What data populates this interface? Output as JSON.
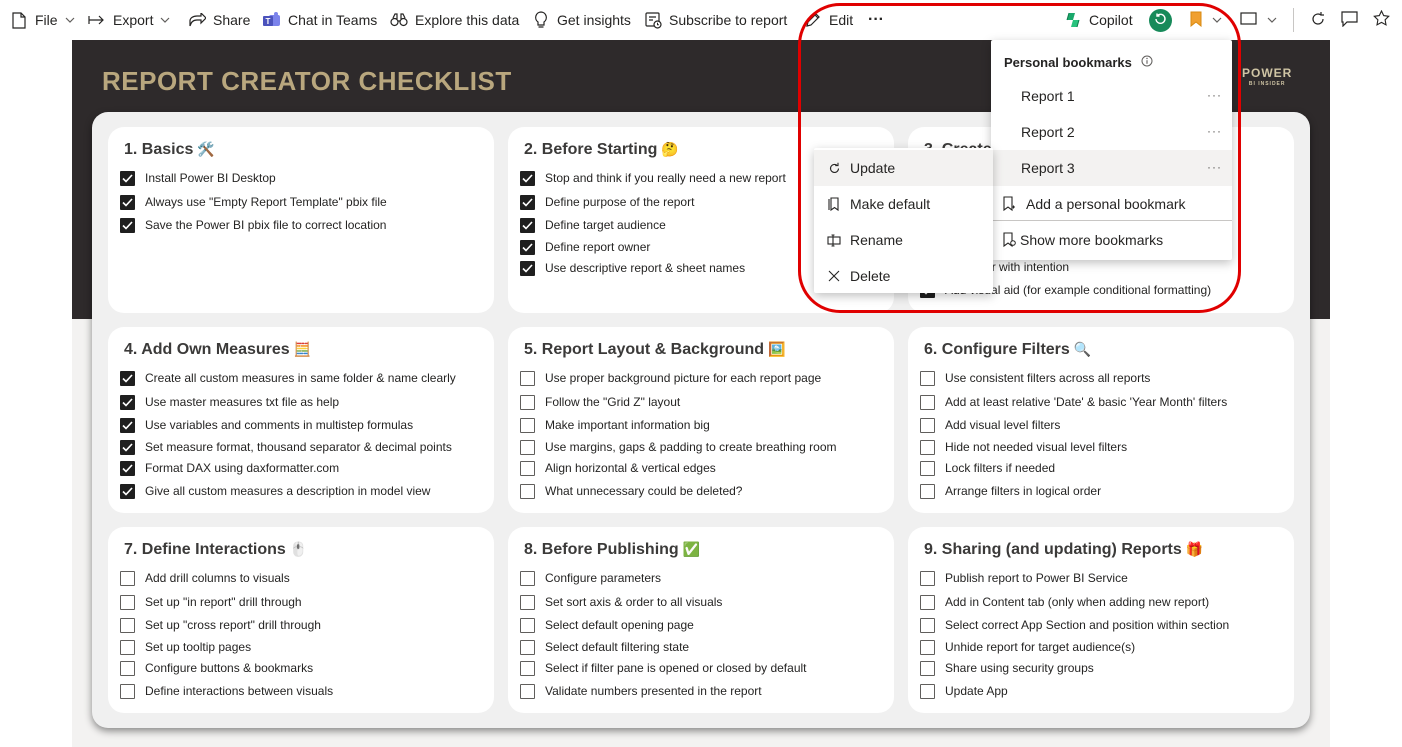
{
  "toolbar": {
    "file": "File",
    "export": "Export",
    "share": "Share",
    "chat_in_teams": "Chat in Teams",
    "explore": "Explore this data",
    "insights": "Get insights",
    "subscribe": "Subscribe to report",
    "edit": "Edit",
    "more": "···",
    "copilot": "Copilot"
  },
  "report": {
    "title": "REPORT CREATOR CHECKLIST",
    "brand": "POWER",
    "brand_sub": "BI INSIDER",
    "colors": {
      "header": "#2e2a2b",
      "title": "#b9a77e",
      "board": "#f0f0f0"
    }
  },
  "cards": [
    {
      "title": "1. Basics",
      "emoji": "🛠️",
      "items": [
        {
          "text": "Install Power BI Desktop",
          "checked": true
        },
        {
          "text": "Always use \"Empty Report Template\" pbix file",
          "checked": true
        },
        {
          "text": "Save the Power BI pbix file to correct location",
          "checked": true
        }
      ]
    },
    {
      "title": "2. Before Starting",
      "emoji": "🤔",
      "items": [
        {
          "text": "Stop and think if you really need a new report",
          "checked": true
        },
        {
          "text": "Define purpose of the report",
          "checked": true
        },
        {
          "text": "Define target audience",
          "checked": true
        },
        {
          "text": "Define report owner",
          "checked": true
        },
        {
          "text": "Use descriptive report & sheet names",
          "checked": true
        }
      ]
    },
    {
      "title": "3. Create",
      "emoji": "",
      "items": [
        {
          "text": "Use color with intention",
          "checked": true
        },
        {
          "text": "Add visual aid (for example conditional formatting)",
          "checked": true
        }
      ]
    },
    {
      "title": "4. Add Own Measures",
      "emoji": "🧮",
      "items": [
        {
          "text": "Create all custom measures in same folder & name clearly",
          "checked": true
        },
        {
          "text": "Use master measures txt file as help",
          "checked": true
        },
        {
          "text": "Use variables and comments in multistep formulas",
          "checked": true
        },
        {
          "text": "Set measure format, thousand separator & decimal points",
          "checked": true
        },
        {
          "text": "Format DAX using daxformatter.com",
          "checked": true
        },
        {
          "text": "Give all custom measures a description in model view",
          "checked": true
        }
      ]
    },
    {
      "title": "5. Report Layout & Background",
      "emoji": "🖼️",
      "items": [
        {
          "text": "Use proper background picture for each report page",
          "checked": false
        },
        {
          "text": "Follow the \"Grid Z\" layout",
          "checked": false
        },
        {
          "text": "Make important information big",
          "checked": false
        },
        {
          "text": "Use margins, gaps & padding to create breathing room",
          "checked": false
        },
        {
          "text": "Align horizontal & vertical edges",
          "checked": false
        },
        {
          "text": "What unnecessary could be deleted?",
          "checked": false
        }
      ]
    },
    {
      "title": "6. Configure Filters",
      "emoji": "🔍",
      "items": [
        {
          "text": "Use consistent filters across all reports",
          "checked": false
        },
        {
          "text": "Add at least relative 'Date' & basic 'Year Month' filters",
          "checked": false
        },
        {
          "text": "Add visual level filters",
          "checked": false
        },
        {
          "text": "Hide not needed visual level filters",
          "checked": false
        },
        {
          "text": "Lock filters if needed",
          "checked": false
        },
        {
          "text": "Arrange filters in logical order",
          "checked": false
        }
      ]
    },
    {
      "title": "7. Define Interactions",
      "emoji": "🖱️",
      "items": [
        {
          "text": "Add drill columns to visuals",
          "checked": false
        },
        {
          "text": "Set up \"in report\" drill through",
          "checked": false
        },
        {
          "text": "Set up \"cross report\" drill through",
          "checked": false
        },
        {
          "text": "Set up tooltip pages",
          "checked": false
        },
        {
          "text": "Configure buttons & bookmarks",
          "checked": false
        },
        {
          "text": "Define interactions between visuals",
          "checked": false
        }
      ]
    },
    {
      "title": "8. Before Publishing",
      "emoji": "✅",
      "items": [
        {
          "text": "Configure parameters",
          "checked": false
        },
        {
          "text": "Set sort axis & order to all visuals",
          "checked": false
        },
        {
          "text": "Select default opening page",
          "checked": false
        },
        {
          "text": "Select default filtering state",
          "checked": false
        },
        {
          "text": "Select if filter pane is opened or closed by default",
          "checked": false
        },
        {
          "text": "Validate numbers presented in the report",
          "checked": false
        }
      ]
    },
    {
      "title": "9. Sharing (and updating) Reports",
      "emoji": "🎁",
      "items": [
        {
          "text": "Publish report to Power BI Service",
          "checked": false
        },
        {
          "text": "Add in Content tab (only when adding new report)",
          "checked": false
        },
        {
          "text": "Select correct App Section and position within section",
          "checked": false
        },
        {
          "text": "Unhide report for target audience(s)",
          "checked": false
        },
        {
          "text": "Share using security groups",
          "checked": false
        },
        {
          "text": "Update App",
          "checked": false
        }
      ]
    }
  ],
  "bookmarks": {
    "header": "Personal bookmarks",
    "items": [
      {
        "label": "Report 1",
        "more": "···"
      },
      {
        "label": "Report 2",
        "more": "···"
      },
      {
        "label": "Report 3",
        "more": "···"
      }
    ],
    "add": "Add a personal bookmark",
    "show_more": "Show more bookmarks"
  },
  "context_menu": {
    "update": "Update",
    "make_default": "Make default",
    "rename": "Rename",
    "delete": "Delete"
  },
  "highlight_color": "#e00000"
}
